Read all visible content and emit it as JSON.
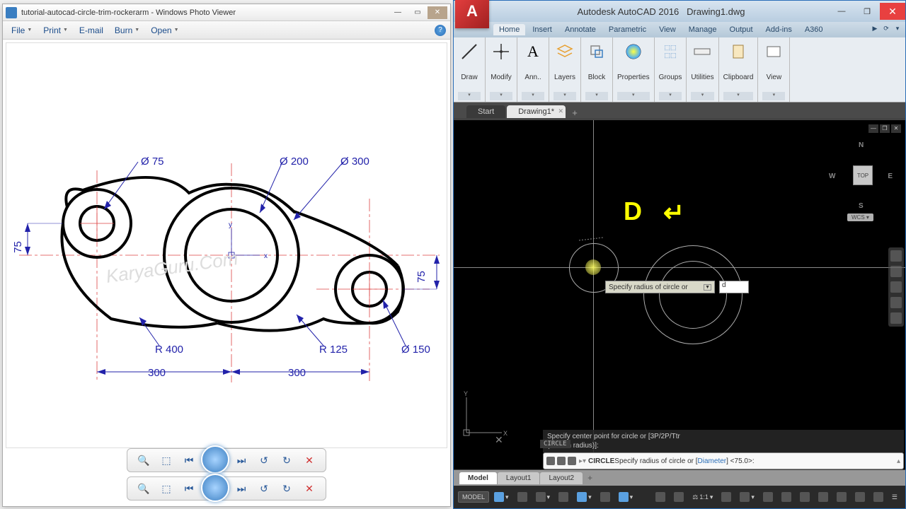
{
  "photo_viewer": {
    "title": "tutorial-autocad-circle-trim-rockerarm - Windows Photo Viewer",
    "menu": {
      "file": "File",
      "print": "Print",
      "email": "E-mail",
      "burn": "Burn",
      "open": "Open"
    },
    "drawing": {
      "d75": "Ø 75",
      "d200": "Ø 200",
      "d300": "Ø 300",
      "d150": "Ø 150",
      "r400": "R 400",
      "r125": "R 125",
      "dim300a": "300",
      "dim300b": "300",
      "dim75a": "75",
      "dim75b": "75",
      "watermark": "KaryaGuru.Com"
    }
  },
  "autocad": {
    "title_app": "Autodesk AutoCAD 2016",
    "title_file": "Drawing1.dwg",
    "logo": "A",
    "tabs": {
      "home": "Home",
      "insert": "Insert",
      "annotate": "Annotate",
      "parametric": "Parametric",
      "view": "View",
      "manage": "Manage",
      "output": "Output",
      "addins": "Add-ins",
      "a360": "A360"
    },
    "ribbon": {
      "draw": "Draw",
      "modify": "Modify",
      "annotation": "Ann..",
      "layers": "Layers",
      "block": "Block",
      "properties": "Properties",
      "groups": "Groups",
      "utilities": "Utilities",
      "clipboard": "Clipboard",
      "viewp": "View"
    },
    "doctabs": {
      "start": "Start",
      "drawing1": "Drawing1*"
    },
    "hint_d": "D",
    "hint_enter": "↵",
    "dyn_prompt": "Specify radius of circle or",
    "dyn_input": "d",
    "viewcube": {
      "n": "N",
      "s": "S",
      "e": "E",
      "w": "W",
      "top": "TOP",
      "wcs": "WCS ▾"
    },
    "ucs_y": "Y",
    "ucs_x": "X",
    "cmd": {
      "badge": "CIRCLE",
      "hist1": "Specify center point for circle or [3P/2P/Ttr",
      "hist2": "(tan tan radius)]:",
      "line_pre": "CIRCLE",
      "line_rest": " Specify radius of circle or [",
      "line_opt": "Diameter",
      "line_tail": "] <75.0>:"
    },
    "layouts": {
      "model": "Model",
      "l1": "Layout1",
      "l2": "Layout2"
    },
    "status": {
      "model": "MODEL",
      "scale": "1:1"
    }
  }
}
